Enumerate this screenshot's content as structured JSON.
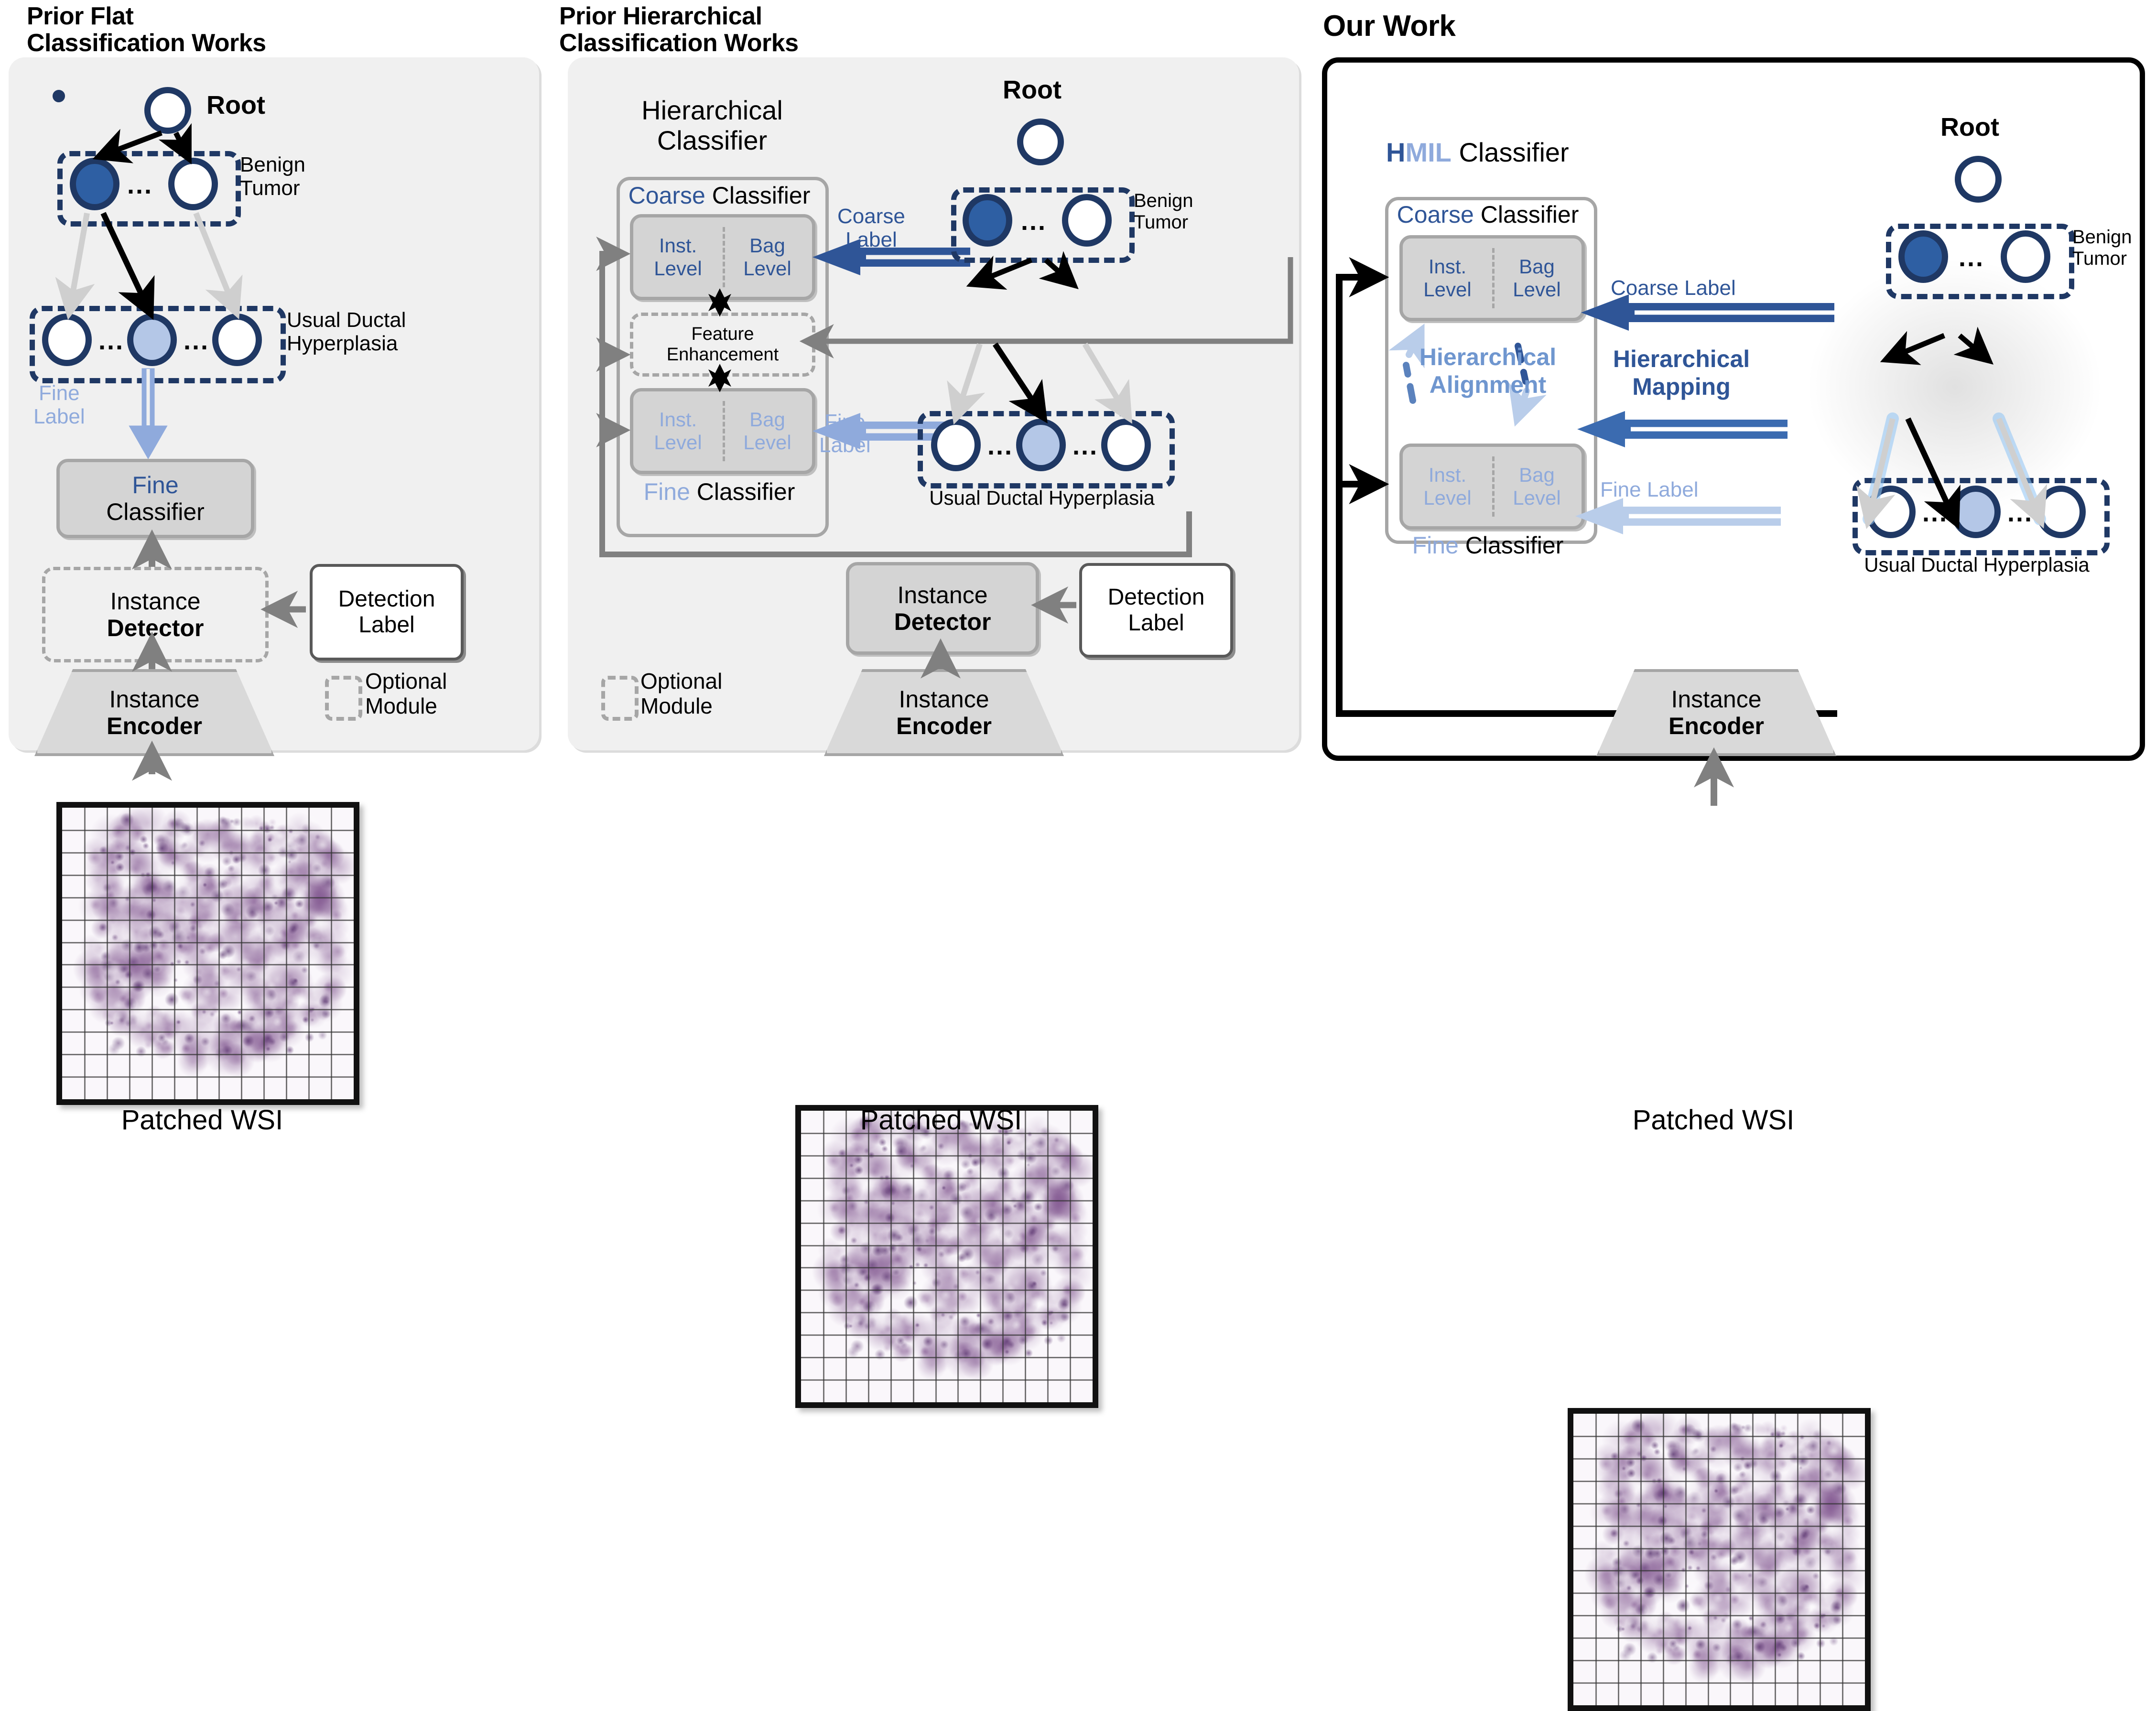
{
  "panels": [
    {
      "id": "flat",
      "title": "Prior Flat\nClassification Works",
      "tree": {
        "root_label": "Root",
        "level1_label": "Benign\nTumor",
        "level2_label": "Usual Ductal\nHyperplasia",
        "dots": "..."
      },
      "fine_label_arrow": "Fine\nLabel",
      "fine_classifier": {
        "accent": "Fine",
        "rest": "Classifier"
      },
      "instance_detector": {
        "line1": "Instance",
        "line2": "Detector"
      },
      "instance_encoder": {
        "line1": "Instance",
        "line2": "Encoder"
      },
      "detection_label": "Detection\nLabel",
      "optional_module": "Optional\nModule",
      "wsi_caption": "Patched WSI"
    },
    {
      "id": "hier",
      "title": "Prior Hierarchical\nClassification Works",
      "hierarchical_classifier_title": "Hierarchical\nClassifier",
      "coarse_classifier": {
        "accent": "Coarse",
        "rest": "Classifier"
      },
      "fine_classifier": {
        "accent": "Fine",
        "rest": "Classifier"
      },
      "level_cells": {
        "inst": "Inst.\nLevel",
        "bag": "Bag\nLevel"
      },
      "feature_enhancement": "Feature\nEnhancement",
      "coarse_label_arrow": "Coarse\nLabel",
      "fine_label_arrow": "Fine\nLabel",
      "tree": {
        "root_label": "Root",
        "level1_label": "Benign\nTumor",
        "level2_label": "Usual Ductal Hyperplasia",
        "dots": "..."
      },
      "instance_detector": {
        "line1": "Instance",
        "line2": "Detector"
      },
      "instance_encoder": {
        "line1": "Instance",
        "line2": "Encoder"
      },
      "detection_label": "Detection\nLabel",
      "optional_module": "Optional\nModule",
      "wsi_caption": "Patched WSI"
    },
    {
      "id": "ours",
      "title": "Our Work",
      "hmil_title": {
        "h": "H",
        "mil": "MIL",
        "rest": "Classifier"
      },
      "coarse_classifier": {
        "accent": "Coarse",
        "rest": "Classifier"
      },
      "fine_classifier": {
        "accent": "Fine",
        "rest": "Classifier"
      },
      "level_cells": {
        "inst": "Inst.\nLevel",
        "bag": "Bag\nLevel"
      },
      "hierarchical_alignment": "Hierarchical\nAlignment",
      "hierarchical_mapping": "Hierarchical\nMapping",
      "coarse_label_arrow": "Coarse Label",
      "fine_label_arrow": "Fine Label",
      "tree": {
        "root_label": "Root",
        "level1_label": "Benign\nTumor",
        "level2_label": "Usual Ductal Hyperplasia",
        "dots": "..."
      },
      "instance_encoder": {
        "line1": "Instance",
        "line2": "Encoder"
      },
      "wsi_caption": "Patched WSI"
    }
  ],
  "colors": {
    "navy": "#1f3864",
    "node_dark": "#2e5fa3",
    "node_light": "#b4c7e7",
    "accent_blue": "#2f5597",
    "accent_light_blue": "#8faadc",
    "panel_bg": "#f0f0f0",
    "grey_border": "#a6a6a6",
    "grey_fill": "#d4d4d4"
  }
}
